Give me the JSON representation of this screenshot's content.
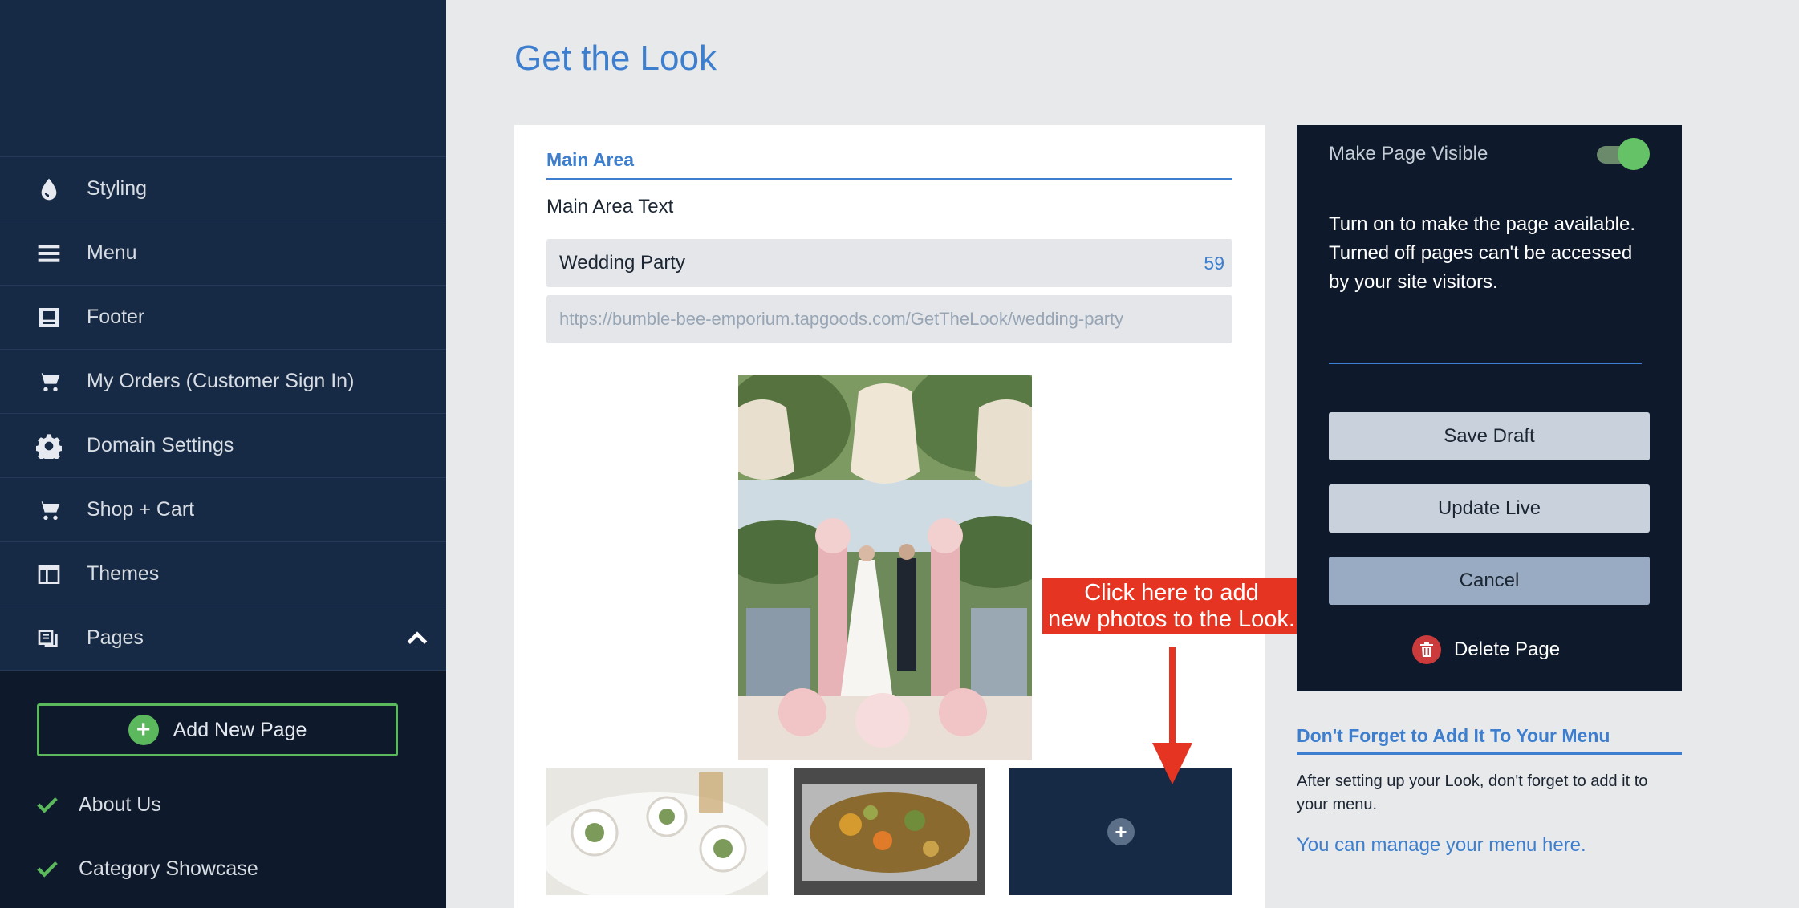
{
  "sidebar": {
    "items": [
      {
        "label": "Styling",
        "icon": "drop-icon"
      },
      {
        "label": "Menu",
        "icon": "menu-icon"
      },
      {
        "label": "Footer",
        "icon": "footer-icon"
      },
      {
        "label": "My Orders (Customer Sign In)",
        "icon": "cart-icon"
      },
      {
        "label": "Domain Settings",
        "icon": "gear-icon"
      },
      {
        "label": "Shop + Cart",
        "icon": "cart-icon"
      },
      {
        "label": "Themes",
        "icon": "themes-icon"
      },
      {
        "label": "Pages",
        "icon": "pages-icon"
      }
    ],
    "add_page_label": "Add New Page",
    "pages": [
      {
        "label": "About Us"
      },
      {
        "label": "Category Showcase"
      }
    ]
  },
  "header": {
    "title": "Get the Look"
  },
  "main": {
    "section_tab": "Main Area",
    "field_label": "Main Area Text",
    "name_value": "Wedding Party",
    "name_count": "59",
    "url_value": "https://bumble-bee-emporium.tapgoods.com/GetTheLook/wedding-party"
  },
  "annotation": {
    "line1": "Click here to add",
    "line2": "new photos to the Look."
  },
  "panel": {
    "visible_label": "Make Page Visible",
    "help_text": "Turn on to make the page available. Turned off pages can't be accessed by your site visitors.",
    "save_draft": "Save Draft",
    "update_live": "Update Live",
    "cancel": "Cancel",
    "delete_page": "Delete Page"
  },
  "reminder": {
    "title": "Don't Forget to Add It To Your Menu",
    "text": "After setting up your Look, don't forget to add it to your menu.",
    "link": "You can manage your menu here."
  },
  "colors": {
    "sidebar_bg": "#172a45",
    "accent_blue": "#3d7fce",
    "success_green": "#5cb85c",
    "annotation_red": "#e53522",
    "danger_red": "#cc3b3b"
  }
}
